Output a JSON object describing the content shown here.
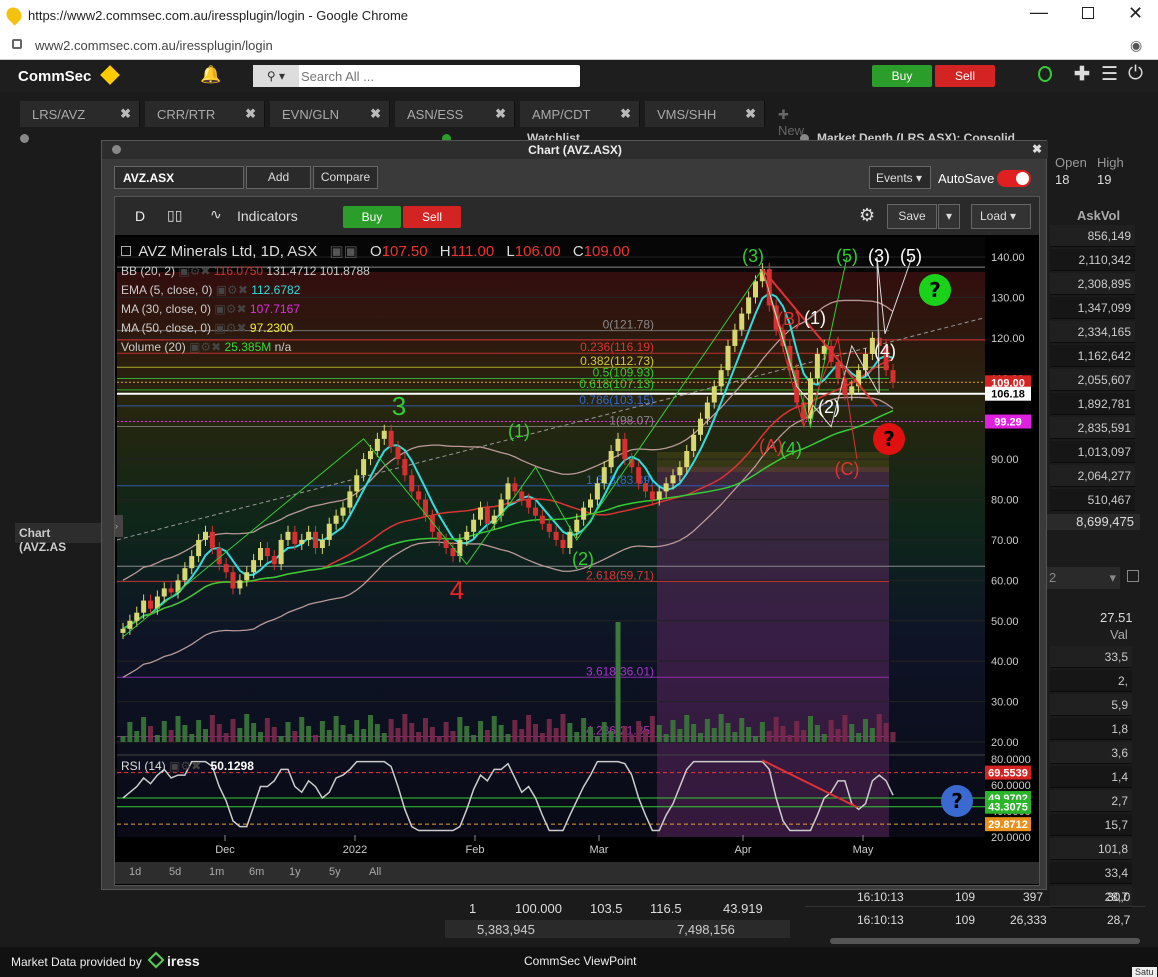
{
  "browser": {
    "title": "https://www2.commsec.com.au/iressplugin/login - Google Chrome",
    "url": "www2.commsec.com.au/iressplugin/login"
  },
  "nav": {
    "logo": "CommSec",
    "search_placeholder": "Search All ...",
    "buy": "Buy",
    "sell": "Sell"
  },
  "tabs": [
    {
      "label": "LRS/AVZ"
    },
    {
      "label": "CRR/RTR"
    },
    {
      "label": "EVN/GLN"
    },
    {
      "label": "ASN/ESS"
    },
    {
      "label": "AMP/CDT"
    },
    {
      "label": "VMS/SHH"
    }
  ],
  "new_tab": "New",
  "watchlist_title": "Watchlist",
  "market_depth_title": "Market Depth (LRS.ASX): Consolid...",
  "market_depth": {
    "open_label": "Open",
    "high_label": "High",
    "open": "18",
    "high": "19",
    "askvol_header": "AskVol",
    "askvol": [
      "856,149",
      "2,110,342",
      "2,308,895",
      "1,347,099",
      "2,334,165",
      "1,162,642",
      "2,055,607",
      "1,892,781",
      "2,835,591",
      "1,013,097",
      "2,064,277",
      "510,467"
    ],
    "total": "8,699,475",
    "val_top": "27.51",
    "val_header": "Val",
    "val_rows": [
      "33,5",
      "2,",
      "5,9",
      "1,8",
      "3,6",
      "1,4",
      "2,7",
      "15,7",
      "101,8",
      "33,4",
      "28,7"
    ]
  },
  "left_chart_label": "Chart (AVZ.AS",
  "chart_window": {
    "title": "Chart (AVZ.ASX)",
    "symbol": "AVZ.ASX",
    "add": "Add",
    "compare": "Compare",
    "events": "Events",
    "autosave": "AutoSave",
    "period": "D",
    "indicators": "Indicators",
    "buy": "Buy",
    "sell": "Sell",
    "save": "Save",
    "load": "Load",
    "header": {
      "name": "AVZ Minerals Ltd, 1D, ASX",
      "o_label": "O",
      "o": "107.50",
      "h_label": "H",
      "h": "111.00",
      "l_label": "L",
      "l": "106.00",
      "c_label": "C",
      "c": "109.00"
    },
    "studies": [
      {
        "label": "BB (20, 2)",
        "values": [
          "116.0750",
          "131.4712",
          "101.8788"
        ]
      },
      {
        "label": "EMA (5, close, 0)",
        "values": [
          "112.6782"
        ]
      },
      {
        "label": "MA (30, close, 0)",
        "values": [
          "107.7167"
        ]
      },
      {
        "label": "MA (50, close, 0)",
        "values": [
          "97.2300"
        ]
      },
      {
        "label": "Volume (20)",
        "values": [
          "25.385M",
          "n/a"
        ]
      }
    ],
    "price_axis": [
      "140.00",
      "130.00",
      "120.00",
      "110.00",
      "100.00",
      "90.00",
      "80.00",
      "70.00",
      "60.00",
      "50.00",
      "40.00",
      "30.00",
      "20.00"
    ],
    "price_tags": {
      "last": "109.00",
      "cross": "106.18",
      "ma50": "99.29"
    },
    "fib_labels": [
      "0(121.78)",
      "0.236(116.19)",
      "0.382(112.73)",
      "0.5(109.93)",
      "0.618(107.13)",
      "0.786(103.15)",
      "1(98.07)",
      "1.618(83.39)",
      "2.618(59.71)",
      "3.618(36.01)",
      "4.236(21.35)"
    ],
    "wave_labels": [
      "3",
      "4",
      "(1)",
      "(2)",
      "(3)",
      "(4)",
      "(5)",
      "(1)",
      "(2)",
      "(3)",
      "(4)",
      "(5)",
      "(A)",
      "(B)",
      "(C)"
    ],
    "rsi": {
      "label": "RSI (14)",
      "value": "50.1298",
      "axis": [
        "80.0000",
        "60.0000",
        "40.0000",
        "20.0000"
      ],
      "tags": [
        "69.5539",
        "49.9702",
        "43.3075",
        "29.8712"
      ]
    },
    "x_axis": [
      "Dec",
      "2022",
      "Feb",
      "Mar",
      "Apr",
      "May"
    ],
    "timeframes": [
      "1d",
      "5d",
      "1m",
      "6m",
      "1y",
      "5y",
      "All"
    ]
  },
  "bottom_row": {
    "cells": [
      "1",
      "100.000",
      "103.5",
      "116.5",
      "43.919"
    ],
    "totals": [
      "5,383,945",
      "7,498,156"
    ]
  },
  "trades": [
    {
      "time": "16:10:13",
      "a": "109",
      "b": "397",
      "c": "30,0"
    },
    {
      "time": "16:10:13",
      "a": "109",
      "b": "26,333",
      "c": "28,7"
    }
  ],
  "footer": {
    "provider": "Market Data provided by",
    "brand": "iress",
    "center": "CommSec ViewPoint",
    "right": "Satu"
  }
}
